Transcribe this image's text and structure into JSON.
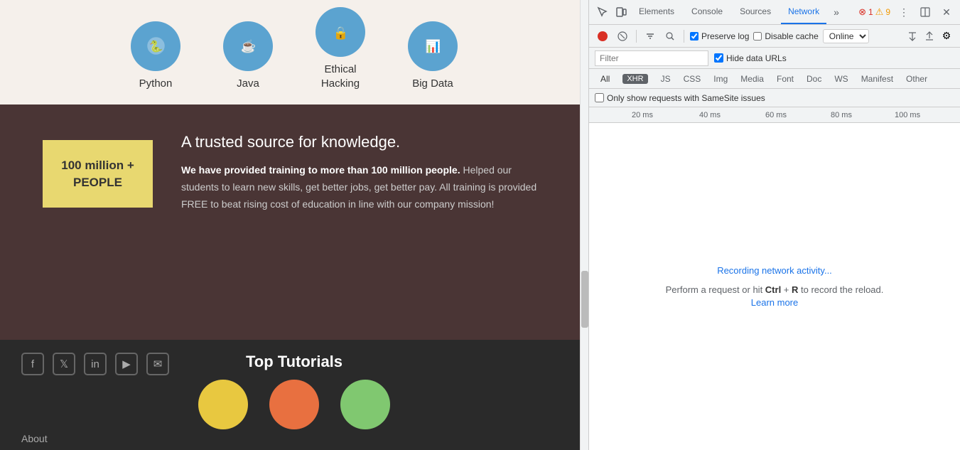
{
  "website": {
    "courses": [
      {
        "label": "Python",
        "icon_type": "python"
      },
      {
        "label": "Java",
        "icon_type": "java"
      },
      {
        "label": "Ethical\nHacking",
        "icon_type": "ethical"
      },
      {
        "label": "Big Data",
        "icon_type": "bigdata"
      }
    ],
    "trust": {
      "heading": "A trusted source for knowledge.",
      "badge_line1": "100 million +",
      "badge_line2": "PEOPLE",
      "body_bold": "We have provided training to more than 100 million people.",
      "body_rest": " Helped our students to learn new skills, get better jobs, get better pay. All training is provided FREE to beat rising cost of education in line with our company mission!"
    },
    "footer": {
      "title": "Top Tutorials",
      "about_label": "About"
    }
  },
  "devtools": {
    "tabs": [
      {
        "label": "Elements",
        "active": false
      },
      {
        "label": "Console",
        "active": false
      },
      {
        "label": "Sources",
        "active": false
      },
      {
        "label": "Network",
        "active": true
      },
      {
        "label": "»",
        "active": false
      }
    ],
    "error_count": "1",
    "warn_count": "9",
    "toolbar": {
      "preserve_log_label": "Preserve log",
      "disable_cache_label": "Disable cache",
      "online_label": "Online"
    },
    "filter": {
      "placeholder": "Filter",
      "hide_data_urls_label": "Hide data URLs"
    },
    "filter_tabs": [
      "All",
      "XHR",
      "JS",
      "CSS",
      "Img",
      "Media",
      "Font",
      "Doc",
      "WS",
      "Manifest",
      "Other"
    ],
    "samesite": {
      "label": "Only show requests with SameSite issues"
    },
    "timeline": {
      "ticks": [
        "20 ms",
        "40 ms",
        "60 ms",
        "80 ms",
        "100 ms"
      ]
    },
    "network_empty": {
      "recording": "Recording network activity...",
      "perform_text": "Perform a request or hit Ctrl + R to record the reload.",
      "learn_more": "Learn more"
    }
  }
}
